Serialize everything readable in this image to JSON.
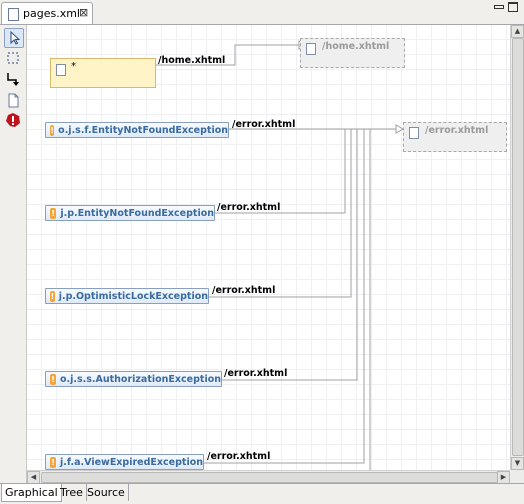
{
  "editor": {
    "tab_title": "pages.xml",
    "close_symbol": "⊠"
  },
  "palette": {
    "items": [
      "select-tool",
      "marquee-tool",
      "connection-tool",
      "page-tool",
      "exception-tool"
    ]
  },
  "canvas": {
    "star_page_label": "*",
    "home_path": "/home.xhtml",
    "home_page_label": "/home.xhtml",
    "error_page_label": "/error.xhtml",
    "exceptions": [
      {
        "label": "o.j.s.f.EntityNotFoundException",
        "path": "/error.xhtml"
      },
      {
        "label": "j.p.EntityNotFoundException",
        "path": "/error.xhtml"
      },
      {
        "label": "j.p.OptimisticLockException",
        "path": "/error.xhtml"
      },
      {
        "label": "o.j.s.s.AuthorizationException",
        "path": "/error.xhtml"
      },
      {
        "label": "j.f.a.ViewExpiredException",
        "path": "/error.xhtml"
      }
    ],
    "exception_icon_glyph": "!"
  },
  "bottom_tabs": [
    "Graphical",
    "Tree",
    "Source"
  ],
  "colors": {
    "exception_text": "#3a6aa0",
    "exception_icon": "#f4a53a",
    "star_page_fill": "#fff4c8",
    "connector": "#a0a0a0"
  }
}
